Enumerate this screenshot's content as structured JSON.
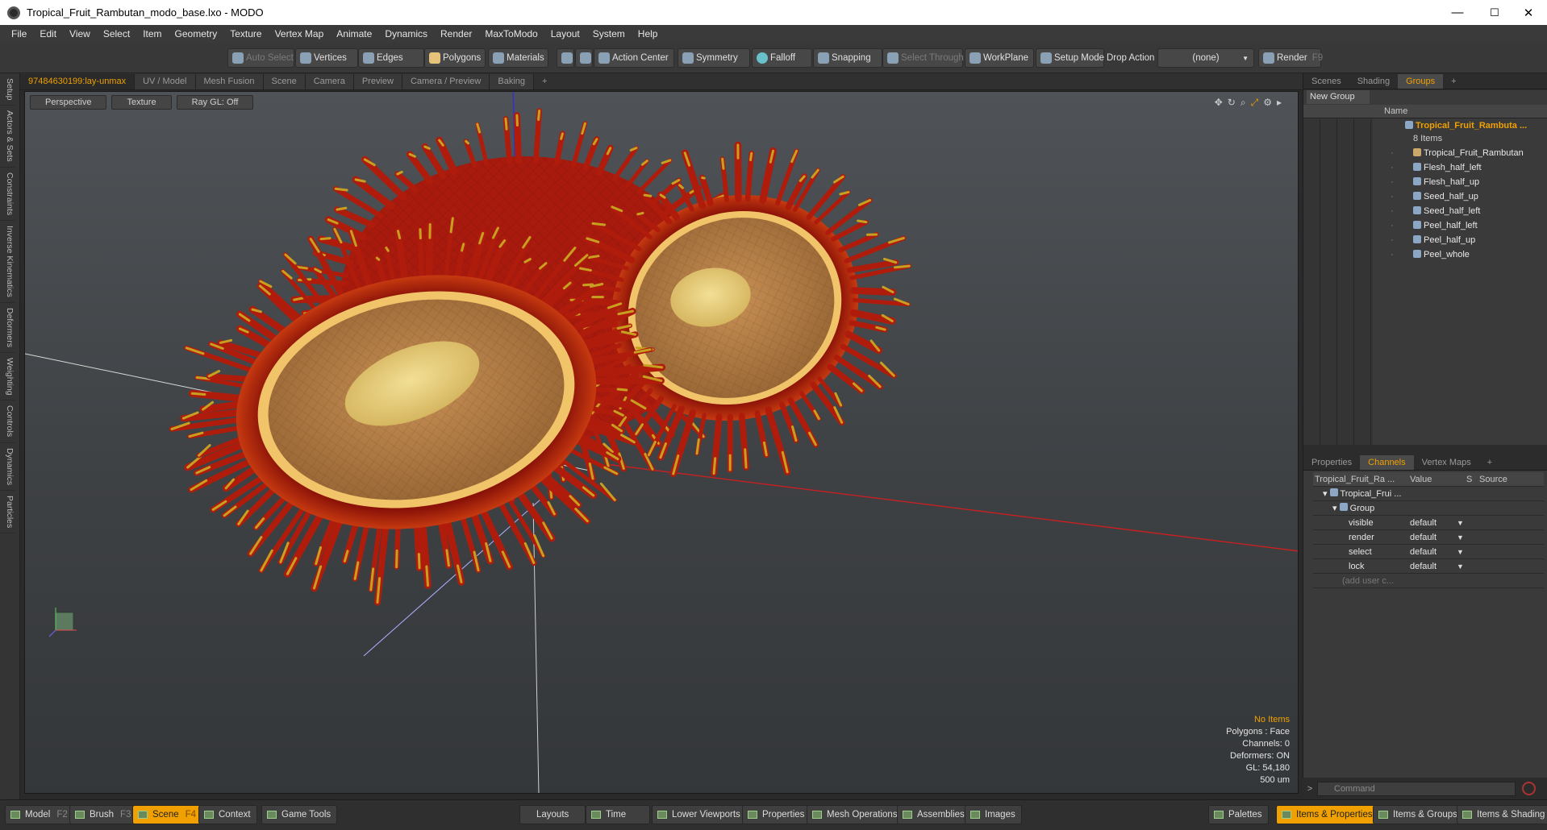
{
  "titlebar": {
    "title": "Tropical_Fruit_Rambutan_modo_base.lxo - MODO",
    "minimize": "—",
    "maximize": "☐",
    "close": "✕"
  },
  "menu": [
    "File",
    "Edit",
    "View",
    "Select",
    "Item",
    "Geometry",
    "Texture",
    "Vertex Map",
    "Animate",
    "Dynamics",
    "Render",
    "MaxToModo",
    "Layout",
    "System",
    "Help"
  ],
  "toolbar": {
    "auto_select": "Auto Select",
    "vertices": "Vertices",
    "edges": "Edges",
    "polygons": "Polygons",
    "materials": "Materials",
    "action_center": "Action Center",
    "symmetry": "Symmetry",
    "falloff": "Falloff",
    "snapping": "Snapping",
    "select_through": "Select Through",
    "workplane": "WorkPlane",
    "setup_mode": "Setup Mode",
    "drop_action_label": "Drop Action",
    "drop_action_value": "(none)",
    "render": "Render",
    "render_key": "F9"
  },
  "left_tabs": [
    "Setup",
    "Actors & Sets",
    "Constraints",
    "Inverse Kinematics",
    "Deformers",
    "Weighting",
    "Controls",
    "Dynamics",
    "Particles"
  ],
  "viewport_tabs": [
    "97484630199:lay-unmax",
    "UV / Model",
    "Mesh Fusion",
    "Scene",
    "Camera",
    "Preview",
    "Camera / Preview",
    "Baking",
    "+"
  ],
  "viewport": {
    "view_mode": "Perspective",
    "shading": "Texture",
    "raygl": "Ray GL: Off",
    "info": {
      "items": "No Items",
      "polygons": "Polygons : Face",
      "channels": "Channels: 0",
      "deformers": "Deformers: ON",
      "gl": "GL: 54,180",
      "unit": "500 um"
    }
  },
  "groups_panel": {
    "tabs": [
      "Scenes",
      "Shading",
      "Groups",
      "+"
    ],
    "new_group": "New Group",
    "name_header": "Name",
    "group_name": "Tropical_Fruit_Rambuta ...",
    "item_count": "8 Items",
    "items": [
      "Tropical_Fruit_Rambutan",
      "Flesh_half_left",
      "Flesh_half_up",
      "Seed_half_up",
      "Seed_half_left",
      "Peel_half_left",
      "Peel_half_up",
      "Peel_whole"
    ]
  },
  "channels_panel": {
    "tabs": [
      "Properties",
      "Channels",
      "Vertex Maps",
      "+"
    ],
    "header_name": "Tropical_Fruit_Ra ...",
    "header_value": "Value",
    "header_s": "S",
    "header_source": "Source",
    "root": "Tropical_Frui ...",
    "group": "Group",
    "rows": [
      {
        "name": "visible",
        "value": "default"
      },
      {
        "name": "render",
        "value": "default"
      },
      {
        "name": "select",
        "value": "default"
      },
      {
        "name": "lock",
        "value": "default"
      }
    ],
    "add_user": "(add user c..."
  },
  "command": {
    "placeholder": "Command",
    "prompt": ">"
  },
  "bottom": {
    "model": "Model",
    "model_key": "F2",
    "brush": "Brush",
    "brush_key": "F3",
    "scene": "Scene",
    "scene_key": "F4",
    "context": "Context",
    "game_tools": "Game Tools",
    "layouts": "Layouts",
    "time": "Time",
    "lower_viewports": "Lower Viewports",
    "properties": "Properties",
    "mesh_operations": "Mesh Operations",
    "assemblies": "Assemblies",
    "images": "Images",
    "palettes": "Palettes",
    "items_properties": "Items & Properties",
    "items_groups": "Items & Groups",
    "items_shading": "Items & Shading"
  },
  "colors": {
    "accent": "#f0a000",
    "peel": "#a8190e",
    "flesh": "#b07a45",
    "seed": "#e7cf7b"
  }
}
